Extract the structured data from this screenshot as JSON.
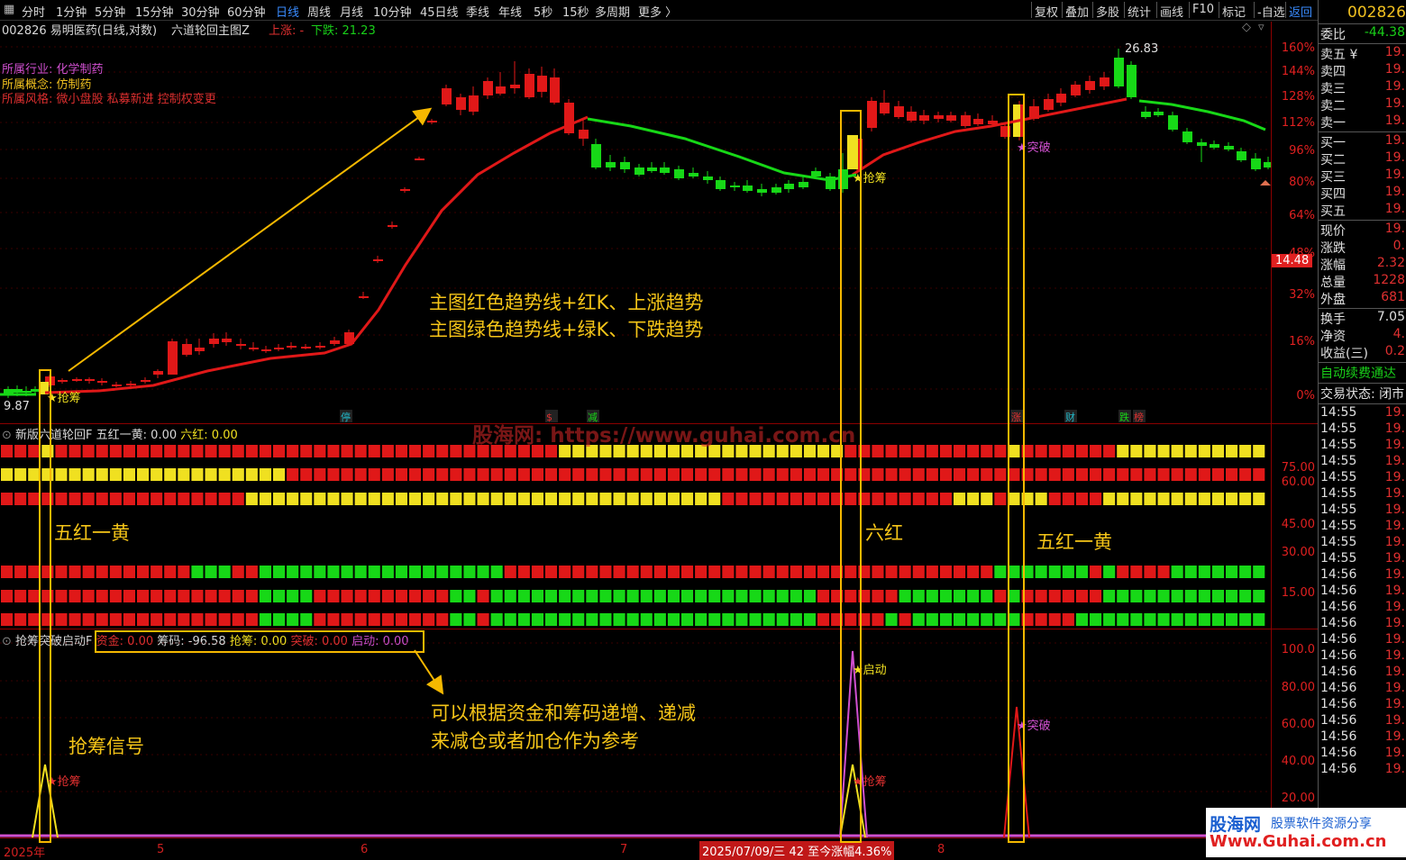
{
  "toolbar": {
    "timeframes": [
      "分时",
      "1分钟",
      "5分钟",
      "15分钟",
      "30分钟",
      "60分钟",
      "日线",
      "周线",
      "月线",
      "10分钟",
      "45日线",
      "季线",
      "年线",
      "5秒",
      "15秒",
      "多周期",
      "更多 〉"
    ],
    "active_timeframe": "日线",
    "right_buttons": [
      "复权",
      "叠加",
      "多股",
      "统计",
      "画线",
      "F10",
      "标记",
      "-自选",
      "返回"
    ]
  },
  "main_title": {
    "stock": "002826 易明医药(日线,对数)",
    "indicator": "六道轮回主图Z",
    "up_label": "上涨: -",
    "down_label": "下跌: 21.23",
    "industry_label": "所属行业: 化学制药",
    "concept_label": "所属概念: 仿制药",
    "style_label": "所属风格: 微小盘股 私募新进 控制权变更"
  },
  "price_axis": {
    "labels": [
      "160%",
      "144%",
      "128%",
      "112%",
      "96%",
      "80%",
      "64%",
      "48%",
      "32%",
      "16%",
      "0%"
    ],
    "current_price": "14.48"
  },
  "main_chart": {
    "high_label": "26.83",
    "low_label": "9.87",
    "signals": {
      "qiangchou": "抢筹",
      "tupo": "突破",
      "qidong": "启动"
    },
    "event_tags": [
      "停",
      "$",
      "减",
      "涨",
      "财",
      "跌",
      "榜"
    ]
  },
  "six_path": {
    "title": "新版六道轮回F",
    "five_red_label": "五红一黄: 0.00",
    "six_red_label": "六红: 0.00",
    "axis": [
      "75.00",
      "60.00",
      "45.00",
      "30.00",
      "15.00"
    ]
  },
  "signal_panel": {
    "title": "抢筹突破启动F",
    "fund": "资金: 0.00",
    "chips": "筹码: -96.58",
    "grab": "抢筹: 0.00",
    "breakout": "突破: 0.00",
    "launch": "启动: 0.00",
    "axis": [
      "100.0",
      "80.00",
      "60.00",
      "40.00",
      "20.00"
    ]
  },
  "annotations": {
    "trend_red": "主图红色趋势线+红K、上涨趋势",
    "trend_green": "主图绿色趋势线+绿K、下跌趋势",
    "five_red_one_yellow_a": "五红一黄",
    "six_red": "六红",
    "five_red_one_yellow_b": "五红一黄",
    "grab_signal": "抢筹信号",
    "advice_line1": "可以根据资金和筹码递增、递减",
    "advice_line2": "来减仓或者加仓作为参考",
    "watermark": "股海网: https://www.guhai.com.cn"
  },
  "date_axis": {
    "labels": [
      "2025年",
      "5",
      "6",
      "7",
      "8"
    ],
    "cursor": "2025/07/09/三 42 至今涨幅4.36%"
  },
  "quote_panel": {
    "code": "002826",
    "weibi_label": "委比",
    "weibi_value": "-44.38",
    "sell": [
      {
        "k": "卖五 ¥",
        "v": "19."
      },
      {
        "k": "卖四",
        "v": "19."
      },
      {
        "k": "卖三",
        "v": "19."
      },
      {
        "k": "卖二",
        "v": "19."
      },
      {
        "k": "卖一",
        "v": "19."
      }
    ],
    "buy": [
      {
        "k": "买一",
        "v": "19."
      },
      {
        "k": "买二",
        "v": "19."
      },
      {
        "k": "买三",
        "v": "19."
      },
      {
        "k": "买四",
        "v": "19."
      },
      {
        "k": "买五",
        "v": "19."
      }
    ],
    "stats": [
      {
        "k": "现价",
        "v": "19."
      },
      {
        "k": "涨跌",
        "v": "0."
      },
      {
        "k": "涨幅",
        "v": "2.32"
      },
      {
        "k": "总量",
        "v": "1228"
      },
      {
        "k": "外盘",
        "v": "681"
      }
    ],
    "stats2": [
      {
        "k": "换手",
        "v": "7.05"
      },
      {
        "k": "净资",
        "v": "4."
      },
      {
        "k": "收益(三)",
        "v": "0.2"
      }
    ],
    "auto_fee": "自动续费通达",
    "trade_state_label": "交易状态:",
    "trade_state_value": "闭市",
    "ticks": [
      {
        "t": "14:55",
        "p": "19."
      },
      {
        "t": "14:55",
        "p": "19."
      },
      {
        "t": "14:55",
        "p": "19."
      },
      {
        "t": "14:55",
        "p": "19."
      },
      {
        "t": "14:55",
        "p": "19."
      },
      {
        "t": "14:55",
        "p": "19."
      },
      {
        "t": "14:55",
        "p": "19."
      },
      {
        "t": "14:55",
        "p": "19."
      },
      {
        "t": "14:55",
        "p": "19."
      },
      {
        "t": "14:55",
        "p": "19."
      },
      {
        "t": "14:56",
        "p": "19."
      },
      {
        "t": "14:56",
        "p": "19."
      },
      {
        "t": "14:56",
        "p": "19."
      },
      {
        "t": "14:56",
        "p": "19."
      },
      {
        "t": "14:56",
        "p": "19."
      },
      {
        "t": "14:56",
        "p": "19."
      },
      {
        "t": "14:56",
        "p": "19."
      },
      {
        "t": "14:56",
        "p": "19."
      },
      {
        "t": "14:56",
        "p": "19."
      },
      {
        "t": "14:56",
        "p": "19."
      },
      {
        "t": "14:56",
        "p": "19."
      },
      {
        "t": "14:56",
        "p": "19."
      },
      {
        "t": "14:56",
        "p": "19."
      }
    ]
  },
  "logo": {
    "site": "股海网",
    "slogan": "股票软件资源分享",
    "url": "Www.Guhai.com.cn"
  }
}
